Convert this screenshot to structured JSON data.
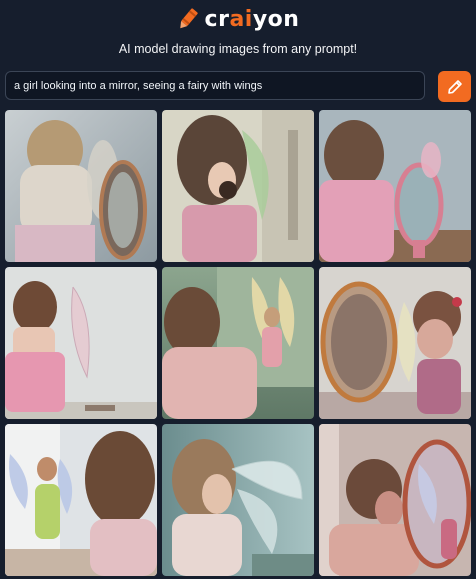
{
  "brand": {
    "name_prefix": "cr",
    "name_accent": "ai",
    "name_suffix": "yon",
    "accent_color": "#f26b21"
  },
  "tagline": "AI model drawing images from any prompt!",
  "prompt": {
    "value": "a girl looking into a mirror, seeing a fairy with wings",
    "placeholder": ""
  },
  "draw_button": {
    "icon": "pencil-icon"
  },
  "results": [
    {
      "id": "result-1"
    },
    {
      "id": "result-2"
    },
    {
      "id": "result-3"
    },
    {
      "id": "result-4"
    },
    {
      "id": "result-5"
    },
    {
      "id": "result-6"
    },
    {
      "id": "result-7"
    },
    {
      "id": "result-8"
    },
    {
      "id": "result-9"
    }
  ]
}
